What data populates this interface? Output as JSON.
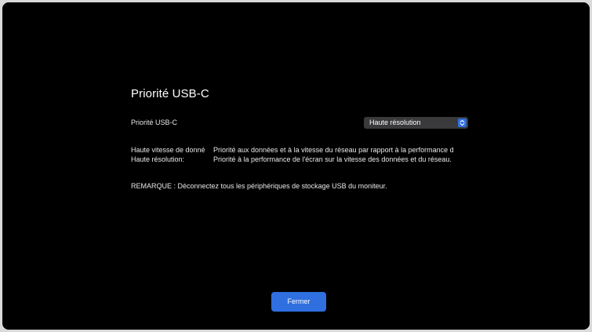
{
  "dialog": {
    "title": "Priorité USB-C",
    "setting_label": "Priorité USB-C",
    "select_value": "Haute résolution",
    "descriptions": [
      {
        "term": "Haute vitesse de donné",
        "definition": "Priorité aux données et à la vitesse du réseau par rapport à la performance d"
      },
      {
        "term": "Haute résolution:",
        "definition": "Priorité à la performance de l'écran sur la vitesse des données et du réseau."
      }
    ],
    "note": "REMARQUE : Déconnectez tous les périphériques de stockage USB du moniteur.",
    "close_label": "Fermer"
  },
  "icons": {
    "select_button": "chevron-up-down-icon"
  },
  "colors": {
    "background": "#000000",
    "accent": "#2f6fe0",
    "select_bg": "#3a3a3c"
  }
}
